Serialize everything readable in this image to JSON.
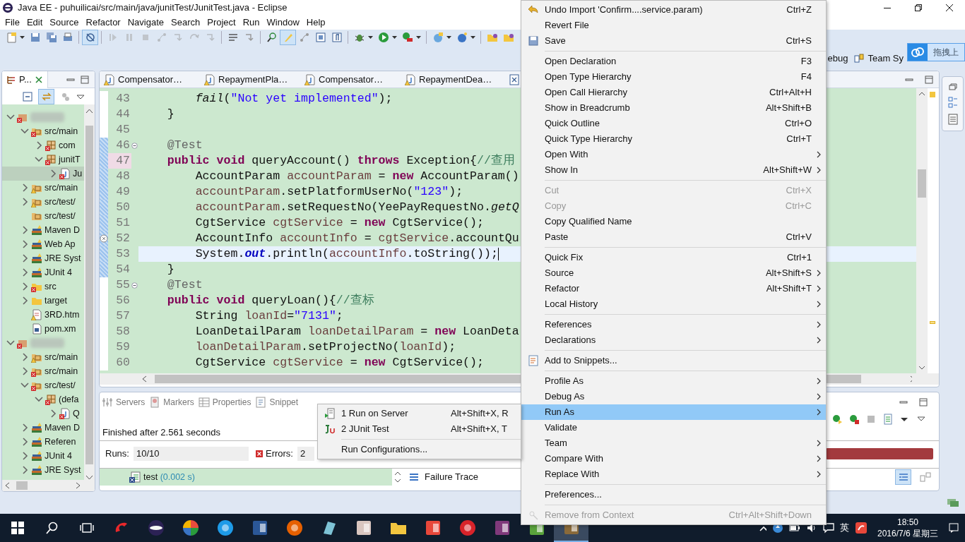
{
  "window": {
    "title": "Java EE - puhuilicai/src/main/java/junitTest/JunitTest.java - Eclipse"
  },
  "menu_bar": [
    "File",
    "Edit",
    "Source",
    "Refactor",
    "Navigate",
    "Search",
    "Project",
    "Run",
    "Window",
    "Help"
  ],
  "toolbar": [
    {
      "kind": "page",
      "active": false,
      "disabled": false,
      "dropdown": true
    },
    {
      "kind": "disk",
      "active": false,
      "disabled": false,
      "dropdown": false
    },
    {
      "kind": "disks",
      "active": false,
      "disabled": false,
      "dropdown": false
    },
    {
      "kind": "printer",
      "active": false,
      "disabled": false,
      "dropdown": false
    },
    {
      "kind": "separator"
    },
    {
      "kind": "link",
      "active": true,
      "disabled": false,
      "dropdown": false
    },
    {
      "kind": "separator"
    },
    {
      "kind": "resume",
      "active": false,
      "disabled": true,
      "dropdown": false
    },
    {
      "kind": "pause",
      "active": false,
      "disabled": true,
      "dropdown": false
    },
    {
      "kind": "stop",
      "active": false,
      "disabled": true,
      "dropdown": false
    },
    {
      "kind": "nodes",
      "active": false,
      "disabled": true,
      "dropdown": false
    },
    {
      "kind": "step",
      "active": false,
      "disabled": true,
      "dropdown": false
    },
    {
      "kind": "loop",
      "active": false,
      "disabled": true,
      "dropdown": false
    },
    {
      "kind": "step",
      "active": false,
      "disabled": true,
      "dropdown": false
    },
    {
      "kind": "separator"
    },
    {
      "kind": "lines",
      "active": false,
      "disabled": false,
      "dropdown": false
    },
    {
      "kind": "step",
      "active": false,
      "disabled": false,
      "dropdown": false
    },
    {
      "kind": "separator"
    },
    {
      "kind": "search",
      "active": false,
      "disabled": false,
      "dropdown": false
    },
    {
      "kind": "brush",
      "active": true,
      "disabled": false,
      "dropdown": false
    },
    {
      "kind": "nodes",
      "active": false,
      "disabled": false,
      "dropdown": false
    },
    {
      "kind": "block",
      "active": false,
      "disabled": false,
      "dropdown": false
    },
    {
      "kind": "pilcrow",
      "active": false,
      "disabled": false,
      "dropdown": false
    },
    {
      "kind": "separator"
    },
    {
      "kind": "bug",
      "active": false,
      "disabled": false,
      "dropdown": true
    },
    {
      "kind": "run",
      "active": false,
      "disabled": false,
      "dropdown": true
    },
    {
      "kind": "toolbox",
      "active": false,
      "disabled": false,
      "dropdown": true
    },
    {
      "kind": "separator"
    },
    {
      "kind": "globe",
      "active": false,
      "disabled": false,
      "dropdown": true
    },
    {
      "kind": "badge",
      "active": false,
      "disabled": false,
      "dropdown": true
    },
    {
      "kind": "separator"
    },
    {
      "kind": "folder",
      "active": false,
      "disabled": false,
      "dropdown": false
    },
    {
      "kind": "folder",
      "active": false,
      "disabled": false,
      "dropdown": false
    }
  ],
  "perspectives": [
    {
      "label": "ebug",
      "icon": false
    },
    {
      "label": "Team Sy",
      "icon": true
    }
  ],
  "upload_button": {
    "label": "拖拽上"
  },
  "explorer": {
    "tab": "P...",
    "tree": [
      {
        "kind": "project",
        "error": true,
        "warning": false,
        "expanded": true,
        "selected": false,
        "children": [
          {
            "label": "src/main",
            "kind": "source-folder",
            "error": true,
            "warning": false,
            "expanded": true,
            "selected": false,
            "children": [
              {
                "label": "com",
                "kind": "package",
                "error": true,
                "warning": false,
                "expanded": false,
                "selected": false
              },
              {
                "label": "junitT",
                "kind": "package",
                "error": true,
                "warning": false,
                "expanded": true,
                "selected": false,
                "children": [
                  {
                    "label": "Ju",
                    "kind": "java-file",
                    "error": true,
                    "warning": false,
                    "expanded": false,
                    "selected": true
                  }
                ]
              }
            ]
          },
          {
            "label": "src/main",
            "kind": "source-folder",
            "error": false,
            "warning": true,
            "expanded": false,
            "selected": false
          },
          {
            "label": "src/test/",
            "kind": "source-folder",
            "error": false,
            "warning": true,
            "expanded": false,
            "selected": false
          },
          {
            "label": "src/test/",
            "kind": "source-folder",
            "error": false,
            "warning": false,
            "selected": false
          },
          {
            "label": "Maven D",
            "kind": "library",
            "error": false,
            "warning": false,
            "expanded": false,
            "selected": false
          },
          {
            "label": "Web Ap",
            "kind": "library",
            "error": false,
            "warning": false,
            "expanded": false,
            "selected": false
          },
          {
            "label": "JRE Syst",
            "kind": "library",
            "error": false,
            "warning": false,
            "expanded": false,
            "selected": false
          },
          {
            "label": "JUnit 4",
            "kind": "library",
            "error": false,
            "warning": false,
            "expanded": false,
            "selected": false
          },
          {
            "label": "src",
            "kind": "folder",
            "error": true,
            "warning": false,
            "expanded": false,
            "selected": false
          },
          {
            "label": "target",
            "kind": "folder",
            "error": false,
            "warning": false,
            "expanded": false,
            "selected": false
          },
          {
            "label": "3RD.htm",
            "kind": "file",
            "error": false,
            "warning": true,
            "selected": false
          },
          {
            "label": "pom.xm",
            "kind": "xml-file",
            "error": false,
            "warning": false,
            "selected": false
          }
        ]
      },
      {
        "kind": "project",
        "error": true,
        "warning": false,
        "expanded": true,
        "selected": false,
        "children": [
          {
            "label": "src/main",
            "kind": "source-folder",
            "error": false,
            "warning": true,
            "expanded": false,
            "selected": false
          },
          {
            "label": "src/main",
            "kind": "source-folder",
            "error": true,
            "warning": false,
            "expanded": false,
            "selected": false
          },
          {
            "label": "src/test/",
            "kind": "source-folder",
            "error": true,
            "warning": false,
            "expanded": true,
            "selected": false,
            "children": [
              {
                "label": "(defa",
                "kind": "package",
                "error": true,
                "warning": false,
                "expanded": true,
                "selected": false,
                "children": [
                  {
                    "label": "Q",
                    "kind": "java-file",
                    "error": true,
                    "warning": false,
                    "expanded": false,
                    "selected": false
                  }
                ]
              }
            ]
          },
          {
            "label": "Maven D",
            "kind": "library",
            "error": false,
            "warning": false,
            "expanded": false,
            "selected": false
          },
          {
            "label": "Referen",
            "kind": "library",
            "error": false,
            "warning": false,
            "expanded": false,
            "selected": false
          },
          {
            "label": "JUnit 4",
            "kind": "library",
            "error": false,
            "warning": false,
            "expanded": false,
            "selected": false
          },
          {
            "label": "JRE Syst",
            "kind": "library",
            "error": false,
            "warning": false,
            "expanded": false,
            "selected": false
          }
        ]
      }
    ]
  },
  "editor": {
    "tabs": [
      {
        "label": "Compensator…"
      },
      {
        "label": "RepaymentPla…"
      },
      {
        "label": "Compensator…"
      },
      {
        "label": "RepaymentDea…"
      }
    ],
    "lines": [
      {
        "number": "43",
        "kind": "plain",
        "current": false,
        "marked": false,
        "changed": false,
        "tokens": [
          {
            "text": "        fail",
            "kind": "static_method"
          },
          {
            "text": "(",
            "kind": "plain"
          },
          {
            "text": "\"Not yet implemented\"",
            "kind": "string"
          },
          {
            "text": ");",
            "kind": "plain"
          }
        ]
      },
      {
        "number": "44",
        "kind": "plain",
        "current": false,
        "marked": false,
        "changed": false,
        "tokens": [
          {
            "text": "    }",
            "kind": "plain"
          }
        ]
      },
      {
        "number": "45",
        "kind": "plain",
        "current": false,
        "marked": false,
        "changed": false
      },
      {
        "number": "46",
        "kind": "fold",
        "current": false,
        "marked": false,
        "changed": true,
        "tokens": [
          {
            "text": "    @Test",
            "kind": "annotation"
          }
        ]
      },
      {
        "number": "47",
        "kind": "plain",
        "current": false,
        "marked": true,
        "changed": true,
        "tokens": [
          {
            "text": "    public void",
            "kind": "keyword"
          },
          {
            "text": " queryAccount() ",
            "kind": "plain"
          },
          {
            "text": "throws",
            "kind": "keyword"
          },
          {
            "text": " Exception{",
            "kind": "plain"
          },
          {
            "text": "//查用",
            "kind": "comment"
          }
        ]
      },
      {
        "number": "48",
        "kind": "plain",
        "current": false,
        "marked": false,
        "changed": true,
        "tokens": [
          {
            "text": "        AccountParam ",
            "kind": "plain"
          },
          {
            "text": "accountParam",
            "kind": "variable"
          },
          {
            "text": " = ",
            "kind": "plain"
          },
          {
            "text": "new",
            "kind": "keyword"
          },
          {
            "text": " AccountParam()",
            "kind": "plain"
          }
        ]
      },
      {
        "number": "49",
        "kind": "plain",
        "current": false,
        "marked": false,
        "changed": true,
        "tokens": [
          {
            "text": "        accountParam",
            "kind": "variable"
          },
          {
            "text": ".setPlatformUserNo(",
            "kind": "plain"
          },
          {
            "text": "\"123\"",
            "kind": "string"
          },
          {
            "text": ");",
            "kind": "plain"
          }
        ]
      },
      {
        "number": "50",
        "kind": "plain",
        "current": false,
        "marked": false,
        "changed": true,
        "tokens": [
          {
            "text": "        accountParam",
            "kind": "variable"
          },
          {
            "text": ".setRequestNo(YeePayRequestNo.",
            "kind": "plain"
          },
          {
            "text": "getQ",
            "kind": "static_method"
          }
        ]
      },
      {
        "number": "51",
        "kind": "plain",
        "current": false,
        "marked": false,
        "changed": true,
        "tokens": [
          {
            "text": "        CgtService ",
            "kind": "plain"
          },
          {
            "text": "cgtService",
            "kind": "variable"
          },
          {
            "text": " = ",
            "kind": "plain"
          },
          {
            "text": "new",
            "kind": "keyword"
          },
          {
            "text": " CgtService();",
            "kind": "plain"
          }
        ]
      },
      {
        "number": "52",
        "kind": "error",
        "current": false,
        "marked": false,
        "changed": true,
        "tokens": [
          {
            "text": "        AccountInfo ",
            "kind": "plain"
          },
          {
            "text": "accountInfo",
            "kind": "variable"
          },
          {
            "text": " = ",
            "kind": "plain"
          },
          {
            "text": "cgtService",
            "kind": "variable"
          },
          {
            "text": ".accountQu",
            "kind": "plain"
          }
        ]
      },
      {
        "number": "53",
        "kind": "plain",
        "current": true,
        "marked": false,
        "changed": true,
        "tokens": [
          {
            "text": "        System.",
            "kind": "plain"
          },
          {
            "text": "out",
            "kind": "static_field"
          },
          {
            "text": ".println(",
            "kind": "plain"
          },
          {
            "text": "accountInfo",
            "kind": "variable"
          },
          {
            "text": ".toString());",
            "kind": "plain"
          }
        ]
      },
      {
        "number": "54",
        "kind": "plain",
        "current": false,
        "marked": false,
        "changed": true,
        "tokens": [
          {
            "text": "    }",
            "kind": "plain"
          }
        ]
      },
      {
        "number": "55",
        "kind": "fold",
        "current": false,
        "marked": false,
        "changed": false,
        "tokens": [
          {
            "text": "    @Test",
            "kind": "annotation"
          }
        ]
      },
      {
        "number": "56",
        "kind": "plain",
        "current": false,
        "marked": false,
        "changed": false,
        "tokens": [
          {
            "text": "    public void",
            "kind": "keyword"
          },
          {
            "text": " queryLoan(){",
            "kind": "plain"
          },
          {
            "text": "//查标",
            "kind": "comment"
          }
        ]
      },
      {
        "number": "57",
        "kind": "plain",
        "current": false,
        "marked": false,
        "changed": false,
        "tokens": [
          {
            "text": "        String ",
            "kind": "plain"
          },
          {
            "text": "loanId",
            "kind": "variable"
          },
          {
            "text": "=",
            "kind": "plain"
          },
          {
            "text": "\"7131\"",
            "kind": "string"
          },
          {
            "text": ";",
            "kind": "plain"
          }
        ]
      },
      {
        "number": "58",
        "kind": "plain",
        "current": false,
        "marked": false,
        "changed": false,
        "tokens": [
          {
            "text": "        LoanDetailParam ",
            "kind": "plain"
          },
          {
            "text": "loanDetailParam",
            "kind": "variable"
          },
          {
            "text": " = ",
            "kind": "plain"
          },
          {
            "text": "new",
            "kind": "keyword"
          },
          {
            "text": " LoanDeta",
            "kind": "plain"
          }
        ]
      },
      {
        "number": "59",
        "kind": "plain",
        "current": false,
        "marked": false,
        "changed": false,
        "tokens": [
          {
            "text": "        loanDetailParam",
            "kind": "variable"
          },
          {
            "text": ".setProjectNo(",
            "kind": "plain"
          },
          {
            "text": "loanId",
            "kind": "variable"
          },
          {
            "text": ");",
            "kind": "plain"
          }
        ]
      },
      {
        "number": "60",
        "kind": "plain",
        "current": false,
        "marked": false,
        "changed": false,
        "tokens": [
          {
            "text": "        CgtService ",
            "kind": "plain"
          },
          {
            "text": "cgtService",
            "kind": "variable"
          },
          {
            "text": " = ",
            "kind": "plain"
          },
          {
            "text": "new",
            "kind": "keyword"
          },
          {
            "text": " CgtService();",
            "kind": "plain"
          }
        ]
      }
    ]
  },
  "bottom_panel": {
    "tabs": [
      {
        "label": "Servers",
        "kind": "servers"
      },
      {
        "label": "Markers",
        "kind": "markers"
      },
      {
        "label": "Properties",
        "kind": "properties"
      },
      {
        "label": "Snippet",
        "kind": "snippets"
      }
    ],
    "status": "Finished after 2.561 seconds",
    "runs_label": "Runs:",
    "runs": "10/10",
    "errors_label": "Errors:",
    "errors": "2",
    "failed": true,
    "tests": [
      {
        "name": "test",
        "time": "(0.002 s)"
      }
    ],
    "failure_trace": "Failure Trace"
  },
  "context_menu": [
    {
      "kind": "undo",
      "label": "Undo Import 'Confirm....service.param)",
      "shortcut": "Ctrl+Z",
      "submenu": false,
      "disabled": false,
      "selected": false
    },
    {
      "kind": "item",
      "label": "Revert File",
      "submenu": false,
      "disabled": false,
      "selected": false
    },
    {
      "kind": "save",
      "label": "Save",
      "shortcut": "Ctrl+S",
      "submenu": false,
      "disabled": false,
      "selected": false
    },
    {
      "kind": "separator"
    },
    {
      "kind": "item",
      "label": "Open Declaration",
      "shortcut": "F3",
      "submenu": false,
      "disabled": false,
      "selected": false
    },
    {
      "kind": "item",
      "label": "Open Type Hierarchy",
      "shortcut": "F4",
      "submenu": false,
      "disabled": false,
      "selected": false
    },
    {
      "kind": "item",
      "label": "Open Call Hierarchy",
      "shortcut": "Ctrl+Alt+H",
      "submenu": false,
      "disabled": false,
      "selected": false
    },
    {
      "kind": "item",
      "label": "Show in Breadcrumb",
      "shortcut": "Alt+Shift+B",
      "submenu": false,
      "disabled": false,
      "selected": false
    },
    {
      "kind": "item",
      "label": "Quick Outline",
      "shortcut": "Ctrl+O",
      "submenu": false,
      "disabled": false,
      "selected": false
    },
    {
      "kind": "item",
      "label": "Quick Type Hierarchy",
      "shortcut": "Ctrl+T",
      "submenu": false,
      "disabled": false,
      "selected": false
    },
    {
      "kind": "item",
      "label": "Open With",
      "submenu": true,
      "disabled": false,
      "selected": false
    },
    {
      "kind": "item",
      "label": "Show In",
      "shortcut": "Alt+Shift+W",
      "submenu": true,
      "disabled": false,
      "selected": false
    },
    {
      "kind": "separator"
    },
    {
      "kind": "item",
      "label": "Cut",
      "shortcut": "Ctrl+X",
      "submenu": false,
      "disabled": true,
      "selected": false
    },
    {
      "kind": "item",
      "label": "Copy",
      "shortcut": "Ctrl+C",
      "submenu": false,
      "disabled": true,
      "selected": false
    },
    {
      "kind": "item",
      "label": "Copy Qualified Name",
      "submenu": false,
      "disabled": false,
      "selected": false
    },
    {
      "kind": "item",
      "label": "Paste",
      "shortcut": "Ctrl+V",
      "submenu": false,
      "disabled": false,
      "selected": false
    },
    {
      "kind": "separator"
    },
    {
      "kind": "item",
      "label": "Quick Fix",
      "shortcut": "Ctrl+1",
      "submenu": false,
      "disabled": false,
      "selected": false
    },
    {
      "kind": "item",
      "label": "Source",
      "shortcut": "Alt+Shift+S",
      "submenu": true,
      "disabled": false,
      "selected": false
    },
    {
      "kind": "item",
      "label": "Refactor",
      "shortcut": "Alt+Shift+T",
      "submenu": true,
      "disabled": false,
      "selected": false
    },
    {
      "kind": "item",
      "label": "Local History",
      "submenu": true,
      "disabled": false,
      "selected": false
    },
    {
      "kind": "separator"
    },
    {
      "kind": "item",
      "label": "References",
      "submenu": true,
      "disabled": false,
      "selected": false
    },
    {
      "kind": "item",
      "label": "Declarations",
      "submenu": true,
      "disabled": false,
      "selected": false
    },
    {
      "kind": "separator"
    },
    {
      "kind": "snippet",
      "label": "Add to Snippets...",
      "submenu": false,
      "disabled": false,
      "selected": false
    },
    {
      "kind": "separator"
    },
    {
      "kind": "item",
      "label": "Profile As",
      "submenu": true,
      "disabled": false,
      "selected": false
    },
    {
      "kind": "item",
      "label": "Debug As",
      "submenu": true,
      "disabled": false,
      "selected": false
    },
    {
      "kind": "item",
      "label": "Run As",
      "submenu": true,
      "disabled": false,
      "selected": true
    },
    {
      "kind": "item",
      "label": "Validate",
      "submenu": false,
      "disabled": false,
      "selected": false
    },
    {
      "kind": "item",
      "label": "Team",
      "submenu": true,
      "disabled": false,
      "selected": false
    },
    {
      "kind": "item",
      "label": "Compare With",
      "submenu": true,
      "disabled": false,
      "selected": false
    },
    {
      "kind": "item",
      "label": "Replace With",
      "submenu": true,
      "disabled": false,
      "selected": false
    },
    {
      "kind": "separator"
    },
    {
      "kind": "item",
      "label": "Preferences...",
      "submenu": false,
      "disabled": false,
      "selected": false
    },
    {
      "kind": "separator"
    },
    {
      "kind": "context",
      "label": "Remove from Context",
      "shortcut": "Ctrl+Alt+Shift+Down",
      "submenu": false,
      "disabled": true,
      "selected": false
    }
  ],
  "run_as_menu": [
    {
      "kind": "server",
      "label": "1 Run on Server",
      "shortcut": "Alt+Shift+X, R"
    },
    {
      "kind": "junit",
      "label": "2 JUnit Test",
      "shortcut": "Alt+Shift+X, T"
    },
    {
      "kind": "separator"
    },
    {
      "kind": "item",
      "label": "Run Configurations..."
    }
  ],
  "taskbar": {
    "apps": [
      {
        "kind": "swirl",
        "color": "#e8282b",
        "active": false
      },
      {
        "kind": "ring",
        "color": "#2c2255",
        "active": false
      },
      {
        "kind": "pinwheel",
        "color": "#f4b400",
        "active": false
      },
      {
        "kind": "circle",
        "color": "#1e9be8",
        "active": false
      },
      {
        "kind": "tile",
        "color": "#2b5797",
        "active": false
      },
      {
        "kind": "circle",
        "color": "#e66000",
        "active": false
      },
      {
        "kind": "slab",
        "color": "#7ec3d6",
        "active": false
      },
      {
        "kind": "tile",
        "color": "#d9c6c0",
        "active": false
      },
      {
        "kind": "folder",
        "color": "#f3c63f",
        "active": false
      },
      {
        "kind": "tile",
        "color": "#e8473a",
        "active": false
      },
      {
        "kind": "circle",
        "color": "#d8232a",
        "active": false
      },
      {
        "kind": "tile",
        "color": "#80397b",
        "active": false
      },
      {
        "kind": "tile",
        "color": "#5aa33c",
        "active": false
      },
      {
        "kind": "tile",
        "color": "#8a6a3a",
        "active": true
      }
    ],
    "ime": "英",
    "time": "18:50",
    "date": "2016/7/6 星期三"
  }
}
